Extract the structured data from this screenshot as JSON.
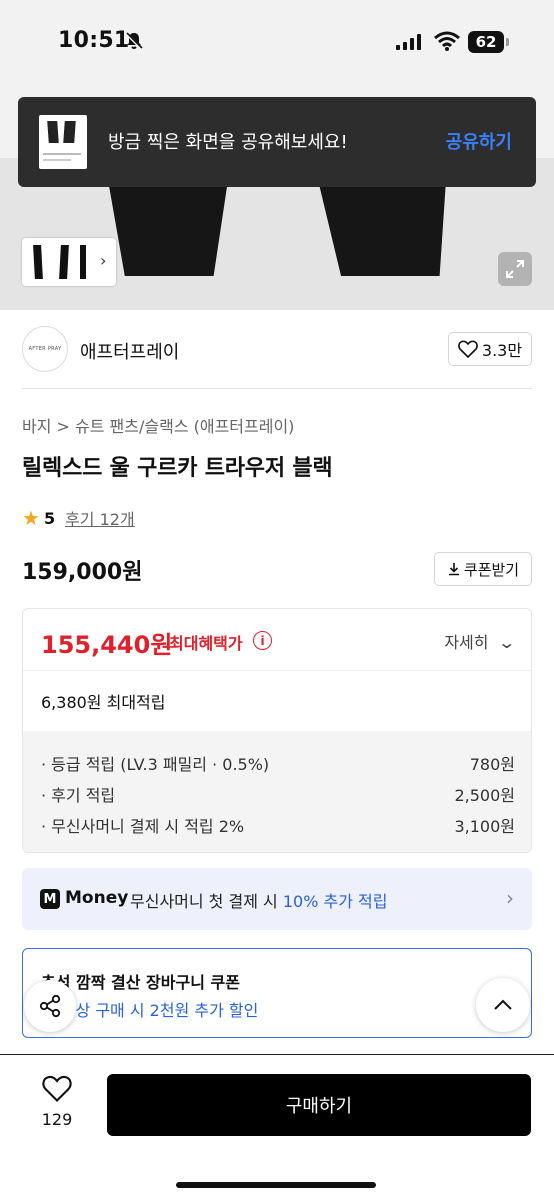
{
  "status_bar": {
    "time": "10:51",
    "battery": "62"
  },
  "toast": {
    "message": "방금 찍은 화면을 공유해보세요!",
    "action": "공유하기"
  },
  "brand": {
    "logo_text": "AFTER PRAY",
    "name": "애프터프레이",
    "likes": "3.3만"
  },
  "product": {
    "breadcrumb": "바지 > 슈트 팬츠/슬랙스 (애프터프레이)",
    "title": "릴렉스드 울 구르카 트라우저 블랙",
    "rating": "5",
    "reviews": "후기 12개",
    "price": "159,000원",
    "coupon_button": "쿠폰받기"
  },
  "benefit": {
    "max_price": "155,440원",
    "max_label": "최대혜택가",
    "detail_toggle": "자세히",
    "points_total": "6,380원 최대적립",
    "rows": [
      {
        "label": "· 등급 적립 (LV.3 패밀리 · 0.5%)",
        "value": "780원"
      },
      {
        "label": "· 후기 적립",
        "value": "2,500원"
      },
      {
        "label": "· 무신사머니 결제 시 적립 2%",
        "value": "3,100원"
      }
    ]
  },
  "money_banner": {
    "logo": "M",
    "brand": "Money",
    "text_prefix": "무신사머니 첫 결제 시 ",
    "highlight": "10% 추가 적립"
  },
  "coupon_banner": {
    "title": "추석 깜짝 결산 장바구니 쿠폰",
    "subtitle": "원 이상 구매 시 2천원 추가 할인"
  },
  "bottom_bar": {
    "wish_count": "129",
    "buy_label": "구매하기"
  },
  "colors": {
    "accent_red": "#e0212d",
    "accent_blue": "#2a62d9",
    "toast_bg": "#2d2d2d"
  }
}
